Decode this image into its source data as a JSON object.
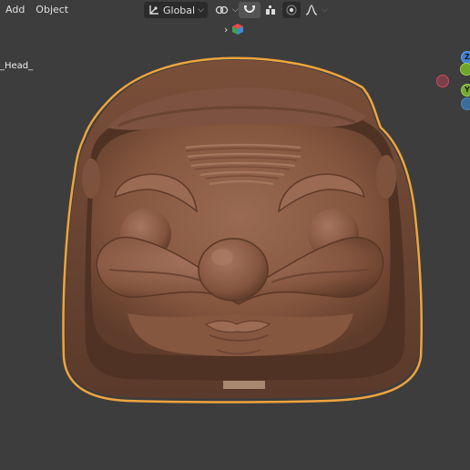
{
  "menu": {
    "add": "Add",
    "object": "Object"
  },
  "header": {
    "orientation_label": "Global",
    "transform_orientation_icon": "transform-axes-icon",
    "pivot_icon": "pivot-link-icon",
    "snap_icon": "magnet-icon",
    "snap_target_icon": "snap-grid-icon",
    "proportional_icon": "proportional-edit-icon",
    "falloff_icon": "falloff-curve-icon"
  },
  "breadcrumb": {
    "expand_icon": "chevron-right-icon",
    "collection_icon": "collection-cube-icon"
  },
  "viewport": {
    "object_name": "_Head_",
    "gizmo": {
      "z_label": "Z",
      "y_label": "Y"
    },
    "model": "sculpted-clay-face-head",
    "selection_outline_color": "#e8912e",
    "clay_color": "#8e5f49"
  }
}
